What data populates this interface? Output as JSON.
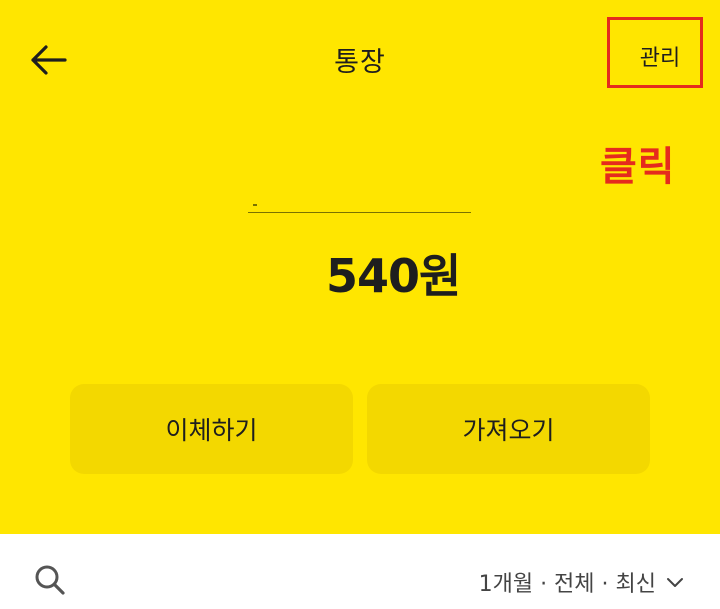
{
  "header": {
    "title": "통장",
    "manage_label": "관리",
    "back_icon": "arrow-left-icon"
  },
  "annotation": {
    "click_label": "클릭",
    "color": "#e52b1d"
  },
  "account": {
    "balance": "540원"
  },
  "actions": {
    "transfer_label": "이체하기",
    "fetch_label": "가져오기"
  },
  "toolbar": {
    "search_icon": "search-icon",
    "filter_label": "1개월 · 전체 · 최신",
    "filter_icon": "chevron-down-icon"
  },
  "colors": {
    "background": "#ffe600",
    "button": "#f3d800",
    "highlight": "#e52b1d"
  }
}
